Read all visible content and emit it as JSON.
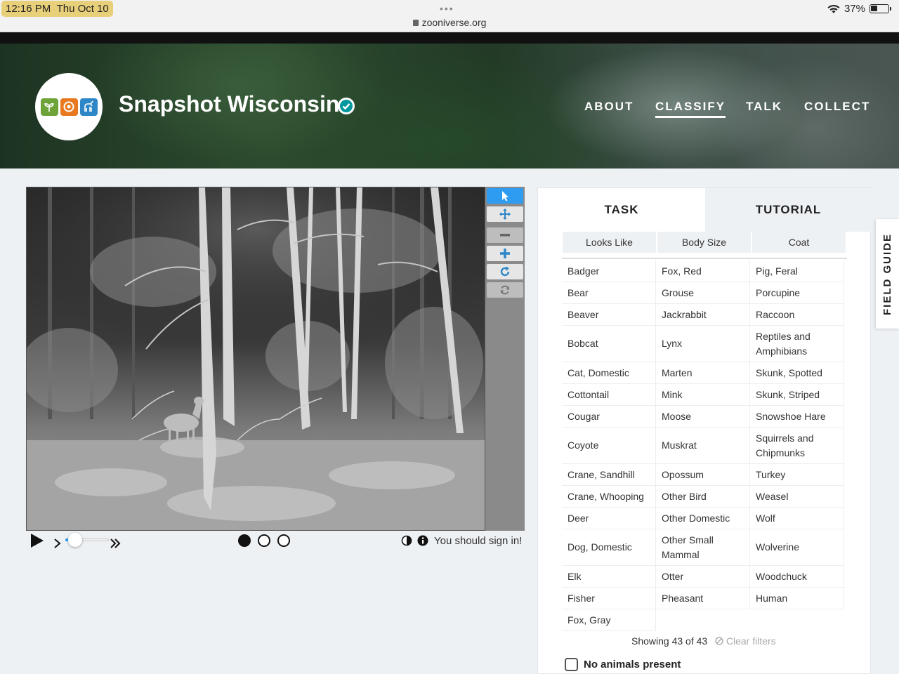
{
  "status_bar": {
    "time": "12:16 PM",
    "date": "Thu Oct 10",
    "url": "zooniverse.org",
    "battery": "37%"
  },
  "header": {
    "title": "Snapshot Wisconsin",
    "nav": [
      "ABOUT",
      "CLASSIFY",
      "TALK",
      "COLLECT"
    ],
    "active_nav": "CLASSIFY"
  },
  "viewer": {
    "signin_text": "You should sign in!",
    "frames": 3,
    "current_frame": 1,
    "playback_speed_fraction": 0.1
  },
  "panel": {
    "tabs": [
      "TASK",
      "TUTORIAL"
    ],
    "active_tab": "TASK",
    "filters": [
      "Looks Like",
      "Body Size",
      "Coat"
    ],
    "choices": {
      "col1": [
        "Badger",
        "Bear",
        "Beaver",
        "Bobcat",
        "Cat, Domestic",
        "Cottontail",
        "Cougar",
        "Coyote",
        "Crane, Sandhill",
        "Crane, Whooping",
        "Deer",
        "Dog, Domestic",
        "Elk",
        "Fisher",
        "Fox, Gray"
      ],
      "col2": [
        "Fox, Red",
        "Grouse",
        "Jackrabbit",
        "Lynx",
        "Marten",
        "Mink",
        "Moose",
        "Muskrat",
        "Opossum",
        "Other Bird",
        "Other Domestic",
        "Other Small Mammal",
        "Otter",
        "Pheasant"
      ],
      "col3": [
        "Pig, Feral",
        "Porcupine",
        "Raccoon",
        "Reptiles and Amphibians",
        "Skunk, Spotted",
        "Skunk, Striped",
        "Snowshoe Hare",
        "Squirrels and Chipmunks",
        "Turkey",
        "Weasel",
        "Wolf",
        "Wolverine",
        "Woodchuck",
        "Human"
      ]
    },
    "showing": "Showing 43 of 43",
    "clear_filters": "Clear filters",
    "no_animals": "No animals present"
  },
  "field_guide": "FIELD GUIDE",
  "colors": {
    "accent": "#2e9cf0",
    "teal": "#00979d",
    "logo_green": "#6ea33a",
    "logo_orange": "#e8791e",
    "logo_blue": "#2e86c7"
  }
}
